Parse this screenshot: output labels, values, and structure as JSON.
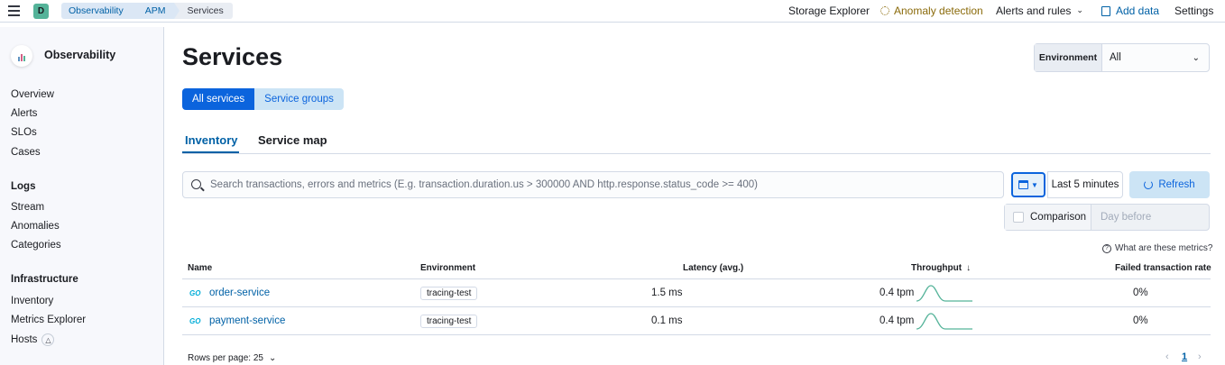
{
  "header": {
    "space_initial": "D",
    "breadcrumbs": [
      "Observability",
      "APM",
      "Services"
    ],
    "links": {
      "storage_explorer": "Storage Explorer",
      "anomaly_detection": "Anomaly detection",
      "alerts_rules": "Alerts and rules",
      "add_data": "Add data",
      "settings": "Settings"
    }
  },
  "sidebar": {
    "title": "Observability",
    "items": [
      "Overview",
      "Alerts",
      "SLOs",
      "Cases"
    ],
    "logs": {
      "title": "Logs",
      "items": [
        "Stream",
        "Anomalies",
        "Categories"
      ]
    },
    "infrastructure": {
      "title": "Infrastructure",
      "items": [
        "Inventory",
        "Metrics Explorer",
        "Hosts"
      ]
    }
  },
  "main": {
    "title": "Services",
    "environment": {
      "label": "Environment",
      "value": "All"
    },
    "service_toggle": [
      "All services",
      "Service groups"
    ],
    "tabs": [
      "Inventory",
      "Service map"
    ],
    "search": {
      "placeholder": "Search transactions, errors and metrics (E.g. transaction.duration.us > 300000 AND http.response.status_code >= 400)"
    },
    "date_range": "Last 5 minutes",
    "refresh_label": "Refresh",
    "comparison": {
      "label": "Comparison",
      "value": "Day before"
    },
    "metrics_help": "What are these metrics?",
    "table": {
      "columns": [
        "Name",
        "Environment",
        "Latency (avg.)",
        "Throughput",
        "Failed transaction rate"
      ],
      "rows": [
        {
          "agent": "GO",
          "name": "order-service",
          "environment": "tracing-test",
          "latency": "1.5 ms",
          "throughput": "0.4 tpm",
          "failed_rate": "0%"
        },
        {
          "agent": "GO",
          "name": "payment-service",
          "environment": "tracing-test",
          "latency": "0.1 ms",
          "throughput": "0.4 tpm",
          "failed_rate": "0%"
        }
      ]
    },
    "pagination": {
      "rows_per_page": "Rows per page: 25",
      "current_page": "1"
    }
  },
  "colors": {
    "accent": "#0b64dd",
    "link": "#0061a6",
    "sparkline": "#54b399"
  }
}
